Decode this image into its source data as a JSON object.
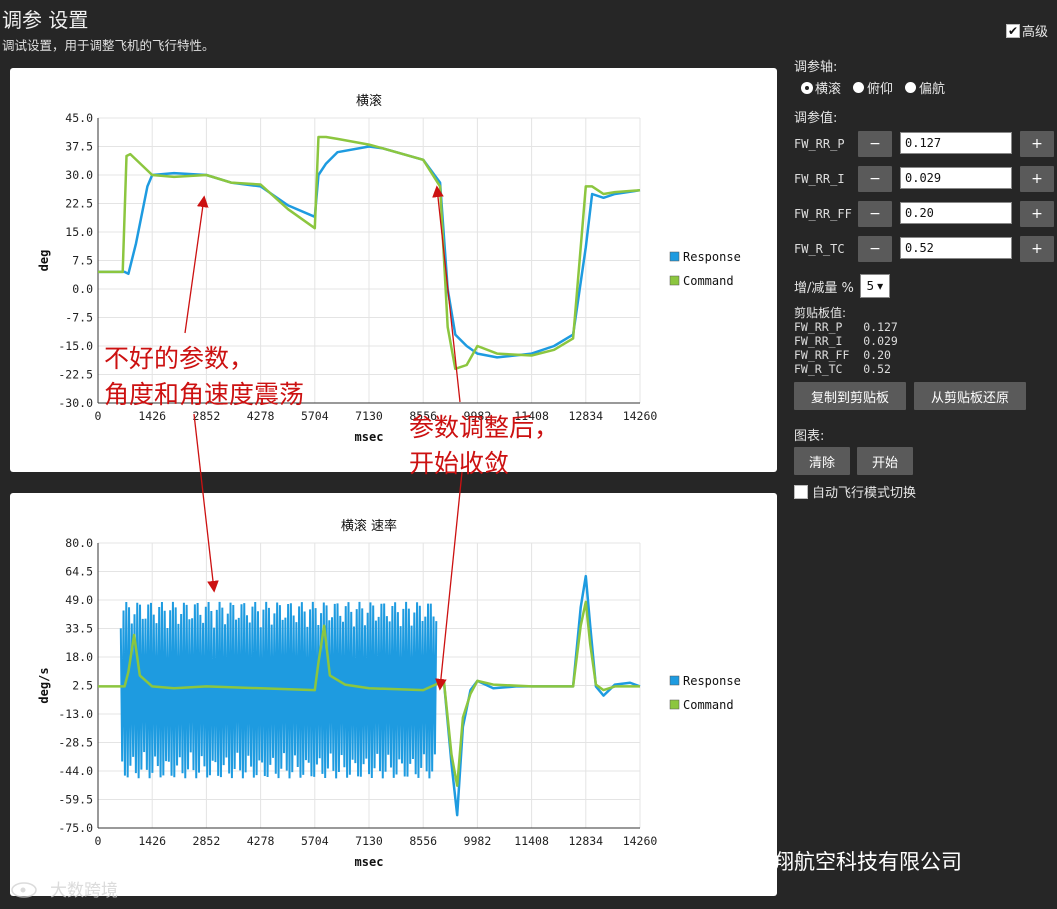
{
  "header": {
    "title": "调参 设置",
    "subtitle": "调试设置，用于调整飞机的飞行特性。"
  },
  "advanced": {
    "label": "高级",
    "checked": true
  },
  "side": {
    "axis_label": "调参轴:",
    "axes": [
      {
        "label": "横滚",
        "selected": true
      },
      {
        "label": "俯仰",
        "selected": false
      },
      {
        "label": "偏航",
        "selected": false
      }
    ],
    "values_label": "调参值:",
    "params": [
      {
        "name": "FW_RR_P",
        "value": "0.127"
      },
      {
        "name": "FW_RR_I",
        "value": "0.029"
      },
      {
        "name": "FW_RR_FF",
        "value": "0.20"
      },
      {
        "name": "FW_R_TC",
        "value": "0.52"
      }
    ],
    "minus": "−",
    "plus": "+",
    "step_label": "增/减量 %",
    "step_value": "5",
    "clipboard_label": "剪贴板值:",
    "clipboard": [
      "FW_RR_P   0.127",
      "FW_RR_I   0.029",
      "FW_RR_FF  0.20",
      "FW_R_TC   0.52"
    ],
    "copy_button": "复制到剪贴板",
    "restore_button": "从剪贴板还原",
    "chart_label": "图表:",
    "clear_button": "清除",
    "start_button": "开始",
    "auto_switch_label": "自动飞行模式切换"
  },
  "annotations": {
    "left_line1": "不好的参数，",
    "left_line2": "角度和角速度震荡",
    "right_line1": "参数调整后，",
    "right_line2": "开始收敛",
    "color": "#cc1111"
  },
  "watermarks": {
    "right": "北京大翔航空科技有限公司",
    "left": "大数跨境"
  },
  "colors": {
    "response": "#1e9be0",
    "command": "#8cc63f"
  },
  "chart_data": [
    {
      "type": "line",
      "title": "横滚",
      "xlabel": "msec",
      "ylabel": "deg",
      "xlim": [
        0,
        14260
      ],
      "ylim": [
        -30,
        45
      ],
      "xticks": [
        "0",
        "1426",
        "2852",
        "4278",
        "5704",
        "7130",
        "8556",
        "9982",
        "11408",
        "12834",
        "14260"
      ],
      "yticks": [
        "45.0",
        "37.5",
        "30.0",
        "22.5",
        "15.0",
        "7.5",
        "0.0",
        "-7.5",
        "-15.0",
        "-22.5",
        "-30.0"
      ],
      "legend_position": "right",
      "series": [
        {
          "name": "Response",
          "color": "#1e9be0",
          "x": [
            0,
            700,
            800,
            1000,
            1300,
            1426,
            2000,
            2852,
            3500,
            4278,
            5000,
            5704,
            5800,
            6000,
            6300,
            7130,
            7500,
            8556,
            9000,
            9200,
            9400,
            9700,
            9982,
            10500,
            11408,
            12000,
            12500,
            12834,
            13000,
            13300,
            13600,
            14260
          ],
          "y": [
            4.5,
            4.5,
            4,
            12,
            27,
            30,
            30.5,
            30,
            28,
            27,
            22,
            19,
            30,
            33,
            36,
            37.5,
            37,
            34,
            28,
            0,
            -12,
            -15,
            -17,
            -18,
            -17,
            -15,
            -12,
            11,
            25,
            24,
            25,
            26
          ]
        },
        {
          "name": "Command",
          "color": "#8cc63f",
          "x": [
            0,
            650,
            750,
            850,
            1426,
            2000,
            2852,
            3500,
            4278,
            5000,
            5704,
            5800,
            5900,
            6000,
            6300,
            7130,
            7500,
            8556,
            9000,
            9200,
            9400,
            9700,
            9982,
            10500,
            11408,
            12000,
            12500,
            12834,
            13000,
            13300,
            13600,
            14260
          ],
          "y": [
            4.5,
            4.5,
            35,
            35.5,
            30,
            29.5,
            30,
            28,
            27.5,
            21,
            16,
            40,
            40,
            40,
            39.5,
            38,
            37,
            34,
            27,
            -10,
            -21,
            -20,
            -15,
            -17,
            -17.5,
            -16,
            -13,
            27,
            27,
            25,
            25.5,
            26
          ]
        }
      ]
    },
    {
      "type": "line",
      "title": "横滚 速率",
      "xlabel": "msec",
      "ylabel": "deg/s",
      "xlim": [
        0,
        14260
      ],
      "ylim": [
        -75,
        80
      ],
      "xticks": [
        "0",
        "1426",
        "2852",
        "4278",
        "5704",
        "7130",
        "8556",
        "9982",
        "11408",
        "12834",
        "14260"
      ],
      "yticks": [
        "80.0",
        "64.5",
        "49.0",
        "33.5",
        "18.0",
        "2.5",
        "-13.0",
        "-28.5",
        "-44.0",
        "-59.5",
        "-75.0"
      ],
      "legend_position": "right",
      "series": [
        {
          "name": "Response",
          "color": "#1e9be0",
          "x": [
            8556,
            9100,
            9300,
            9450,
            9600,
            9800,
            9982,
            10400,
            11000,
            11408,
            12000,
            12500,
            12700,
            12834,
            12950,
            13100,
            13300,
            13600,
            14000,
            14260
          ],
          "y": [
            0,
            5,
            -40,
            -68,
            -20,
            0,
            5,
            1,
            2,
            2,
            2,
            2,
            45,
            62,
            35,
            2,
            -3,
            3,
            4,
            2
          ],
          "oscillation": {
            "x_range": [
              600,
              8900
            ],
            "amplitude": 48,
            "center": 0
          }
        },
        {
          "name": "Command",
          "color": "#8cc63f",
          "x": [
            0,
            700,
            800,
            950,
            1100,
            1426,
            2000,
            2852,
            4278,
            5704,
            5800,
            5950,
            6100,
            6500,
            7130,
            8556,
            9100,
            9300,
            9450,
            9600,
            9800,
            9982,
            10400,
            11408,
            12500,
            12700,
            12834,
            12950,
            13100,
            13300,
            13600,
            14260
          ],
          "y": [
            2,
            2,
            10,
            30,
            8,
            2,
            1,
            2,
            1,
            0,
            15,
            35,
            8,
            3,
            1,
            0,
            5,
            -35,
            -52,
            -15,
            -2,
            5,
            3,
            2,
            2,
            35,
            48,
            25,
            3,
            0,
            2,
            2
          ]
        }
      ]
    }
  ]
}
